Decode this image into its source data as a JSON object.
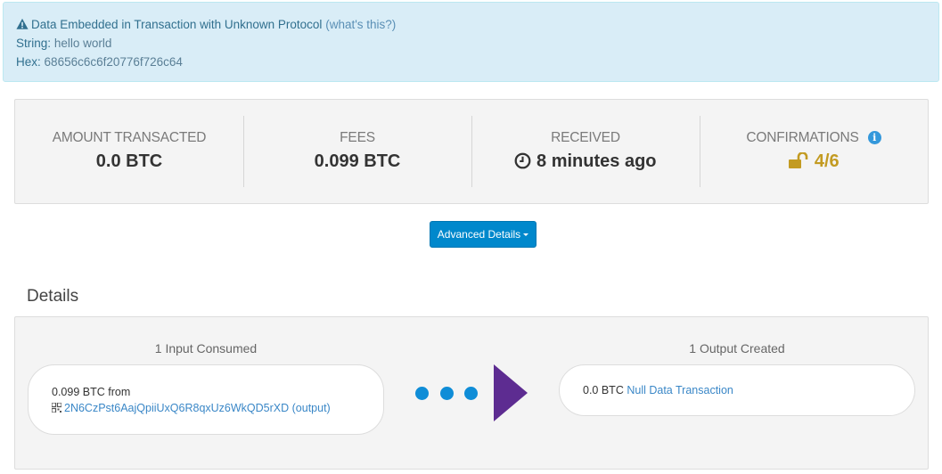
{
  "alert": {
    "title": "Data Embedded in Transaction with Unknown Protocol",
    "help_link": "(what's this?)",
    "string_label": "String",
    "string_value": "hello world",
    "hex_label": "Hex",
    "hex_value": "68656c6c6f20776f726c64"
  },
  "summary": {
    "amount_label": "AMOUNT TRANSACTED",
    "amount_value": "0.0 BTC",
    "fees_label": "FEES",
    "fees_value": "0.099 BTC",
    "received_label": "RECEIVED",
    "received_value": "8 minutes ago",
    "confirmations_label": "CONFIRMATIONS",
    "confirmations_value": "4/6"
  },
  "advanced_details_button": "Advanced Details",
  "details_heading": "Details",
  "inputs": {
    "title": "1 Input Consumed",
    "amount": "0.099 BTC",
    "from_word": "from",
    "address": "2N6CzPst6AajQpiiUxQ6R8qxUz6WkQD5rXD",
    "output_link": "(output)"
  },
  "outputs": {
    "title": "1 Output Created",
    "amount": "0.0 BTC",
    "type_link": "Null Data Transaction"
  },
  "colors": {
    "alert_bg": "#d9edf7",
    "button_bg": "#0088cc",
    "confirm_gold": "#c39b22",
    "arrow_purple": "#5d2c91",
    "dot_blue": "#0f8dd7"
  }
}
